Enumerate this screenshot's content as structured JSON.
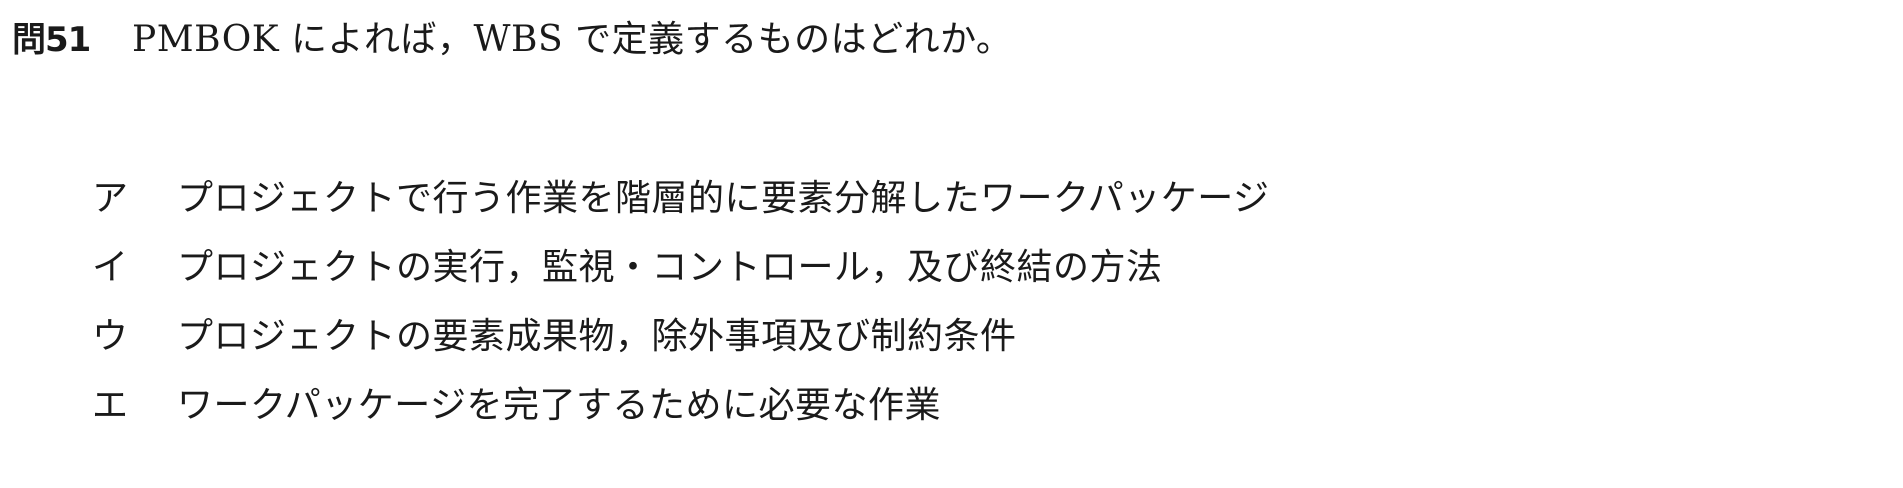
{
  "question": {
    "number": "問51",
    "text": "PMBOK によれば，WBS で定義するものはどれか。"
  },
  "options": [
    {
      "key": "ア",
      "text": "プロジェクトで行う作業を階層的に要素分解したワークパッケージ"
    },
    {
      "key": "イ",
      "text": "プロジェクトの実行，監視・コントロール，及び終結の方法"
    },
    {
      "key": "ウ",
      "text": "プロジェクトの要素成果物，除外事項及び制約条件"
    },
    {
      "key": "エ",
      "text": "ワークパッケージを完了するために必要な作業"
    }
  ]
}
